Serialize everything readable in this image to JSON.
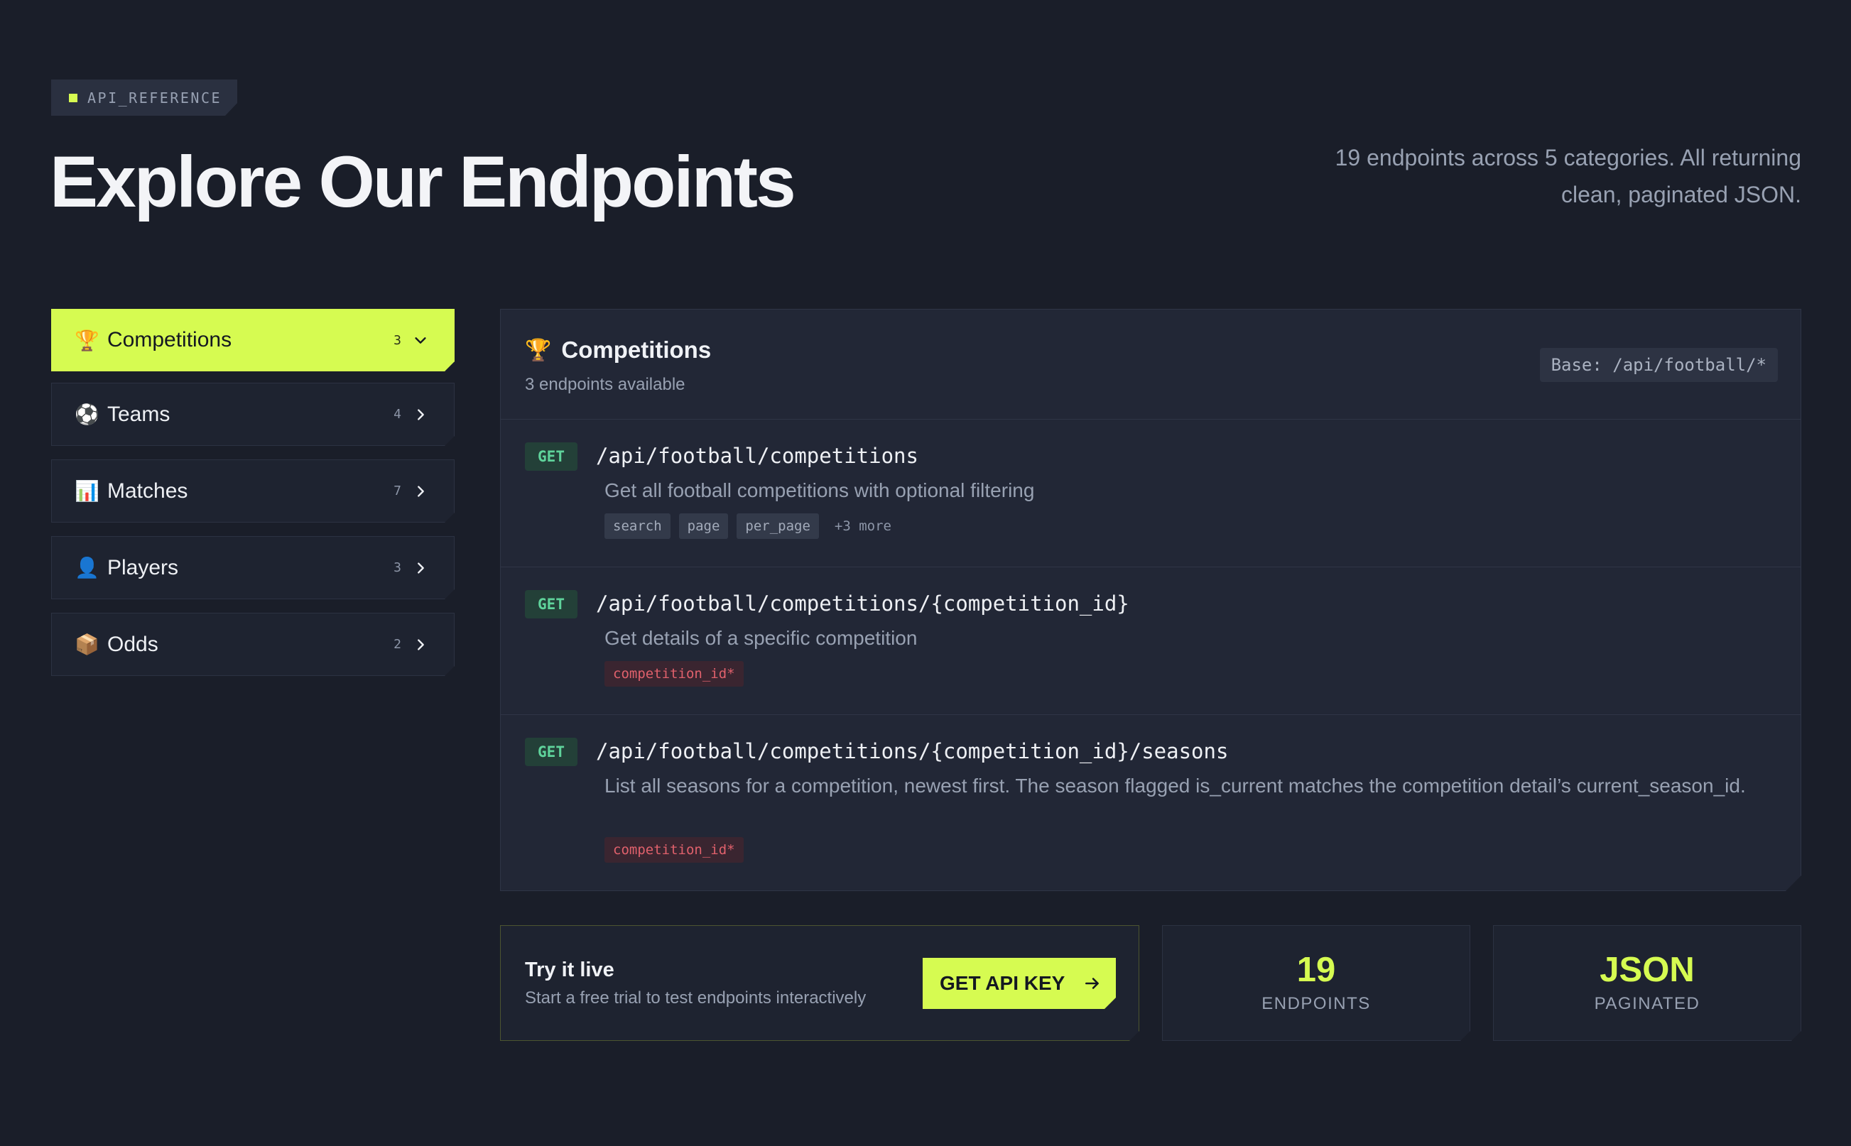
{
  "header": {
    "tag": "API_REFERENCE",
    "title": "Explore Our Endpoints",
    "subtitle": "19 endpoints across 5 categories. All returning clean, paginated JSON."
  },
  "sidebar": {
    "items": [
      {
        "label": "Competitions",
        "count": "3",
        "icon": "trophy-icon",
        "emoji": "🏆",
        "active": true
      },
      {
        "label": "Teams",
        "count": "4",
        "icon": "soccer-ball-icon",
        "emoji": "⚽",
        "active": false
      },
      {
        "label": "Matches",
        "count": "7",
        "icon": "bar-chart-icon",
        "emoji": "📊",
        "active": false
      },
      {
        "label": "Players",
        "count": "3",
        "icon": "person-icon",
        "emoji": "👤",
        "active": false
      },
      {
        "label": "Odds",
        "count": "2",
        "icon": "package-icon",
        "emoji": "📦",
        "active": false
      }
    ]
  },
  "panel": {
    "emoji": "🏆",
    "title": "Competitions",
    "subtitle": "3 endpoints available",
    "base": "Base: /api/football/*",
    "endpoints": [
      {
        "method": "GET",
        "path": "/api/football/competitions",
        "description": "Get all football competitions with optional filtering",
        "params": [
          "search",
          "page",
          "per_page"
        ],
        "more": "+3 more"
      },
      {
        "method": "GET",
        "path": "/api/football/competitions/{competition_id}",
        "description": "Get details of a specific competition",
        "params": [
          "competition_id*"
        ]
      },
      {
        "method": "GET",
        "path": "/api/football/competitions/{competition_id}/seasons",
        "description": "List all seasons for a competition, newest first. The season flagged is_current matches the competition detail’s current_season_id.",
        "params": [
          "competition_id*"
        ]
      }
    ]
  },
  "try_live": {
    "title": "Try it live",
    "subtitle": "Start a free trial to test endpoints interactively",
    "button": "GET API KEY"
  },
  "stats": [
    {
      "value": "19",
      "label": "ENDPOINTS"
    },
    {
      "value": "JSON",
      "label": "PAGINATED"
    }
  ],
  "colors": {
    "background": "#1a1e29",
    "accent": "#d6fb51",
    "get_method": "#5fd39b",
    "required_param": "#e0616c"
  }
}
